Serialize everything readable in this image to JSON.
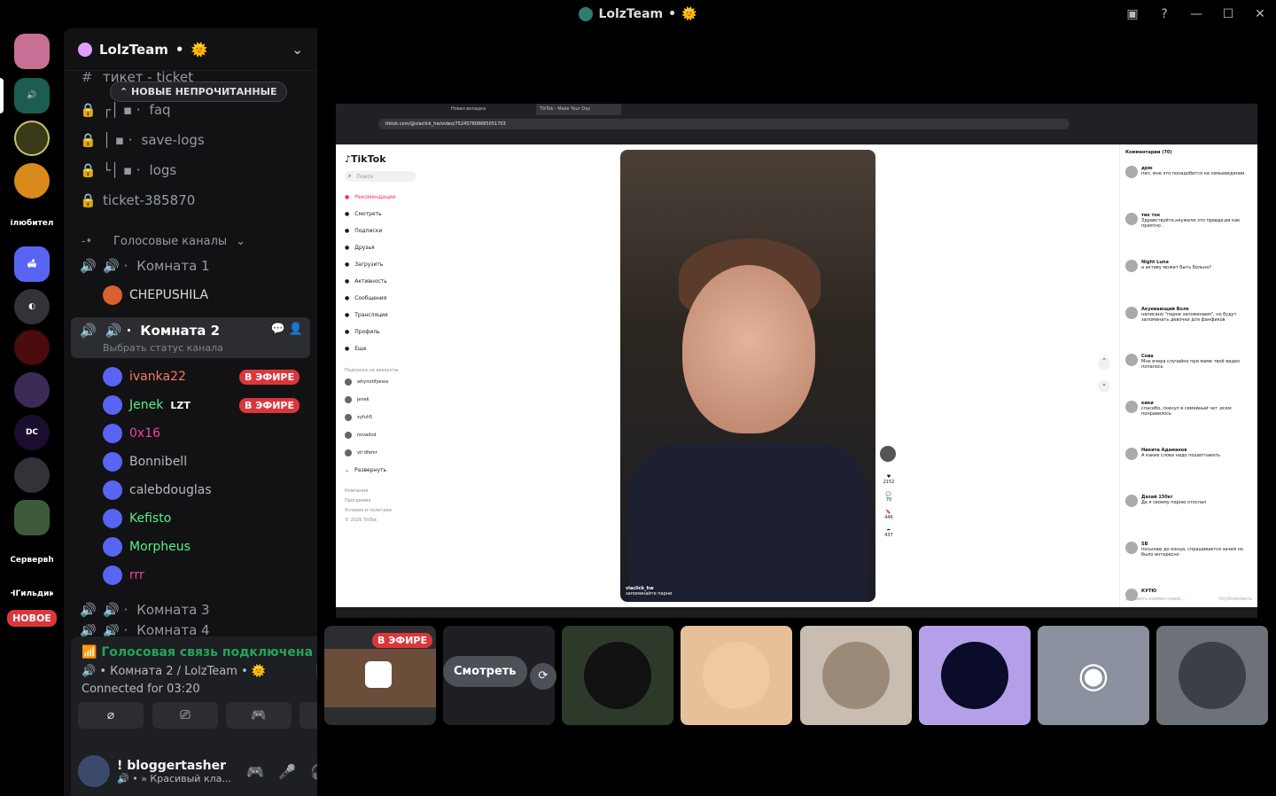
{
  "titlebar": {
    "title": "LolzTeam",
    "emoji": "🌞"
  },
  "rail": {
    "labels": [
      "ілюбител",
      "Сервервh",
      "ЧГильдии"
    ],
    "new_badge": "НОВОЕ"
  },
  "guild": {
    "name": "LolzTeam",
    "emoji": "🌞",
    "new_unread": "НОВЫЕ НЕПРОЧИТАННЫЕ"
  },
  "channels": {
    "partial_top": "тикет - ticket",
    "faq": "faq",
    "save_logs": "save-logs",
    "logs": "logs",
    "ticket": "ticket-385870",
    "voice_category": "Голосовые каналы",
    "room1": "Комната 1",
    "room1_user": "CHEPUSHILA",
    "room2": "Комната 2",
    "room2_status": "Выбрать статус канала",
    "room3": "Комната 3",
    "room4": "Комната 4"
  },
  "voice_users": [
    {
      "name": "ivanka22",
      "live": "В ЭФИРЕ",
      "color": "#f47b67"
    },
    {
      "name": "Jenek",
      "tag": "LZT",
      "live": "В ЭФИРЕ",
      "color": "#57f287"
    },
    {
      "name": "0x16",
      "color": "#eb459e"
    },
    {
      "name": "Bonnibell",
      "color": "#b5bac1"
    },
    {
      "name": "calebdouglas",
      "color": "#b5bac1"
    },
    {
      "name": "Kefisto",
      "color": "#57f287"
    },
    {
      "name": "Morpheus",
      "color": "#57f287"
    },
    {
      "name": "rrr",
      "color": "#eb459e"
    }
  ],
  "voice_panel": {
    "status": "Голосовая связь подключена",
    "room": "Комната 2 / LolzTeam",
    "emoji": "🌞",
    "connected": "Connected for 03:20"
  },
  "user": {
    "name": "! bloggertasher",
    "status": "Красивый кла..."
  },
  "stage": {
    "live_badge": "В ЭФИРЕ",
    "watch": "Смотреть"
  },
  "screen": {
    "url": "tiktok.com/@vlaclick_hw/video/752457808685051703",
    "tab1": "Новая вкладка",
    "tab2": "TikTok - Make Your Day",
    "brand": "TikTok",
    "search": "Поиск",
    "nav": [
      "Рекомендации",
      "Смотреть",
      "Подписки",
      "Друзья",
      "Загрузить",
      "Активность",
      "Сообщения",
      "Трансляция",
      "Профиль",
      "Еще"
    ],
    "following_head": "Подписки на аккаунты",
    "following": [
      "whynotifyesss",
      "jenek",
      "xyfuh5",
      "novadvd",
      "vlr'dfemr"
    ],
    "expand": "Развернуть",
    "footer": [
      "Компания",
      "Программа",
      "Условия и политики",
      "© 2025 TikTok"
    ],
    "video_caption": "vlaclick_hw",
    "video_sub": "запоминайте парни",
    "action_counts": [
      "2152",
      "70",
      "446",
      "437"
    ],
    "comments_head": "Комментарии (70)",
    "comments": [
      {
        "user": "дрю",
        "text": "пап, мне это понадобится на семьеведении"
      },
      {
        "user": "тик ток",
        "text": "Здравствуйте,неужели это правда,ии как приятно ."
      },
      {
        "user": "Night Luna",
        "text": "а активу может быть больно?"
      },
      {
        "user": "Акуевающий Волк",
        "text": "написано \"парни запоминаем\", но будут запоминать девочки для фанфиков"
      },
      {
        "user": "Сова",
        "text": "Мне вчера случайно при маме твоё видео попалось"
      },
      {
        "user": "кики",
        "text": "спасибо, скинул в семейный чат ,всем понравилось"
      },
      {
        "user": "Никита Адаманов",
        "text": "А какие слова надо пошептывать"
      },
      {
        "user": "Дазай 150кг",
        "text": "Да я своему парню отослал"
      },
      {
        "user": "SB",
        "text": "посылаю до конца, спрашивается зачем но было интересно"
      },
      {
        "user": "КУТЮ",
        "text": ""
      }
    ],
    "add_comment": "Добавить комментарий...",
    "publish": "Опубликовать"
  },
  "colors": {
    "accent": "#5865f2",
    "live": "#da373c",
    "online": "#23a55a"
  }
}
